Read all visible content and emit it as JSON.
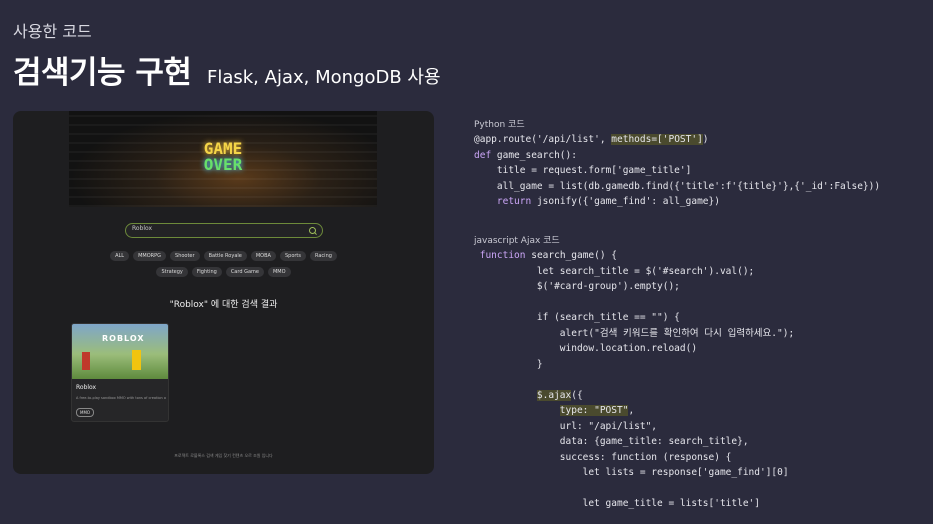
{
  "slide": {
    "kicker": "사용한 코드",
    "title": "검색기능 구현",
    "subtitle": "Flask, Ajax, MongoDB 사용"
  },
  "screenshot": {
    "banner_logo": [
      "GAME",
      "OVER"
    ],
    "search_value": "Roblox",
    "chips_row1": [
      "ALL",
      "MMORPG",
      "Shooter",
      "Battle Royale",
      "MOBA",
      "Sports",
      "Racing"
    ],
    "chips_row2": [
      "Strategy",
      "Fighting",
      "Card Game",
      "MMO"
    ],
    "result_heading": "\"Roblox\" 에 대한 검색 결과",
    "card": {
      "image_logo": "ROBLOX",
      "title": "Roblox",
      "description": "A free-to-play sandbox MMO with tons of creation opt...",
      "tag": "MMO"
    },
    "footer": "프로젝트 로블록스 검색 게임 찾기 컨텐츠 오르 조원 입니다"
  },
  "python": {
    "label": "Python 코드",
    "lines": [
      "@app.route('/api/list', methods=['POST'])",
      "def game_search():",
      "    title = request.form['game_title']",
      "    all_game = list(db.gamedb.find({'title':f'{title}'},{'_id':False}))",
      "    return jsonify({'game_find': all_game})"
    ]
  },
  "javascript": {
    "label": "javascript Ajax 코드",
    "lines": [
      " function search_game() {",
      "           let search_title = $('#search').val();",
      "           $('#card-group').empty();",
      "",
      "           if (search_title == \"\") {",
      "               alert(\"검색 키워드를 확인하여 다시 입력하세요.\");",
      "               window.location.reload()",
      "           }",
      "",
      "           $.ajax({",
      "               type: \"POST\",",
      "               url: \"/api/list\",",
      "               data: {game_title: search_title},",
      "               success: function (response) {",
      "                   let lists = response['game_find'][0]",
      "",
      "                   let game_title = lists['title']"
    ]
  }
}
